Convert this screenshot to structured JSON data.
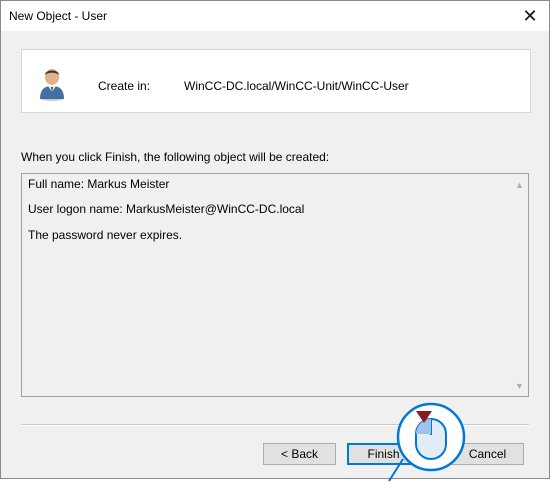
{
  "window": {
    "title": "New Object - User",
    "close_glyph": "✕"
  },
  "header": {
    "icon": "user-icon",
    "create_in_label": "Create in:",
    "create_in_path": "WinCC-DC.local/WinCC-Unit/WinCC-User"
  },
  "summary": {
    "intro": "When you click Finish, the following object will be created:",
    "lines": [
      "Full name: Markus Meister",
      "User logon name: MarkusMeister@WinCC-DC.local",
      "The password never expires."
    ]
  },
  "buttons": {
    "back": "< Back",
    "finish": "Finish",
    "cancel": "Cancel"
  },
  "overlay": {
    "icon": "mouse-click-icon",
    "accent": "#0078d7",
    "arrow_color": "#8b1a1a"
  }
}
